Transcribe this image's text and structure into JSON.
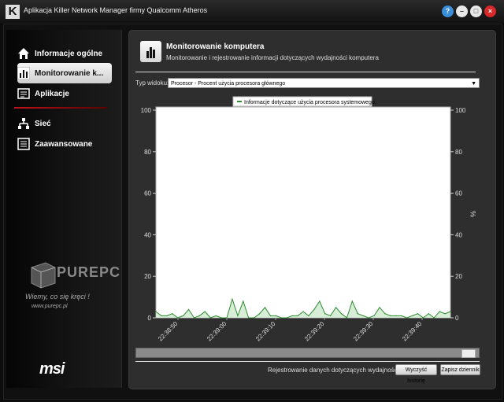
{
  "window": {
    "app_icon": "K",
    "title": "Aplikacja Killer Network Manager firmy Qualcomm Atheros"
  },
  "window_buttons": {
    "help": "?",
    "minimize": "–",
    "restore": "□",
    "close": "×"
  },
  "sidebar": {
    "items": [
      {
        "label": "Informacje ogólne",
        "icon": "home-icon"
      },
      {
        "label": "Monitorowanie k...",
        "icon": "bar-chart-icon",
        "active": true
      },
      {
        "label": "Aplikacje",
        "icon": "apps-icon"
      },
      {
        "label": "Sieć",
        "icon": "network-icon"
      },
      {
        "label": "Zaawansowane",
        "icon": "settings-list-icon"
      }
    ],
    "watermark": {
      "brand": "PUREPC",
      "tagline": "Wiemy, co się kręci !",
      "url": "www.purepc.pl"
    },
    "logo": "msi"
  },
  "header": {
    "title": "Monitorowanie komputera",
    "subtitle": "Monitorowanie i rejestrowanie informacji dotyczących wydajności komputera"
  },
  "view": {
    "label": "Typ widoku:",
    "selected": "Procesor - Procent użycia procesora głównego"
  },
  "chart_data": {
    "type": "area",
    "legend": "Informacje dotyczące użycia procesora systemowego.",
    "y_ticks": [
      "0",
      "20",
      "40",
      "60",
      "80",
      "100"
    ],
    "ylim": [
      0,
      100
    ],
    "ylabel_right": "%",
    "x_tick_labels": [
      "22:38:50",
      "22:39:00",
      "22:39:10",
      "22:39:20",
      "22:39:30",
      "22:39:40"
    ],
    "series": [
      {
        "values": [
          3,
          1,
          1,
          2,
          0,
          1,
          4,
          0,
          1,
          3,
          0,
          1,
          0,
          0,
          9,
          1,
          8,
          0,
          0,
          2,
          5,
          1,
          1,
          0,
          0,
          1,
          1,
          3,
          1,
          4,
          8,
          2,
          1,
          5,
          2,
          0,
          8,
          2,
          1,
          0,
          1,
          5,
          2,
          1,
          1,
          1,
          0,
          1,
          2,
          0,
          2,
          0,
          3,
          2,
          3
        ]
      }
    ],
    "color": "#2e8b2e"
  },
  "footer": {
    "log_label": "Rejestrowanie danych dotyczących wydajności:",
    "clear_button": "Wyczyść historię",
    "save_button": "Zapisz dziennik"
  }
}
